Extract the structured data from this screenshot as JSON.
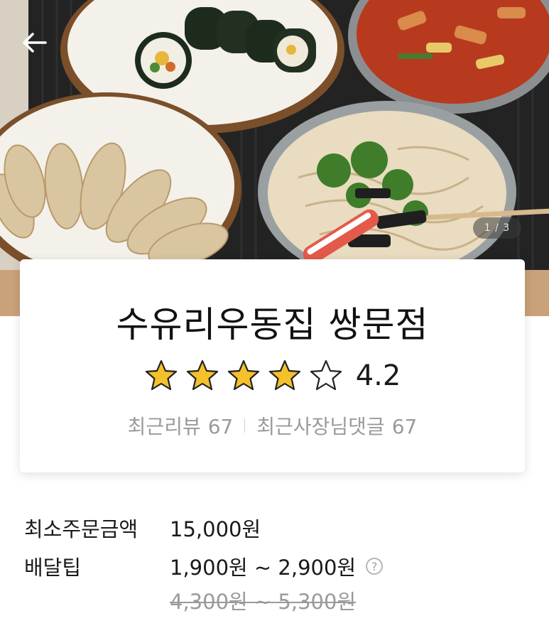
{
  "header": {
    "back_icon": "arrow-left-icon",
    "image_indicator": "1 / 3"
  },
  "store": {
    "name": "수유리우동집 쌍문점",
    "rating": 4.2,
    "rating_text": "4.2",
    "stars_filled": 4,
    "stars_total": 5,
    "recent_reviews_label": "최근리뷰",
    "recent_reviews_count": "67",
    "owner_replies_label": "최근사장님댓글",
    "owner_replies_count": "67"
  },
  "order": {
    "min_order_label": "최소주문금액",
    "min_order_value": "15,000원",
    "delivery_tip_label": "배달팁",
    "delivery_tip_value": "1,900원 ~ 2,900원",
    "delivery_tip_original": "4,300원 ~ 5,300원",
    "help_icon": "question-circle-icon"
  },
  "colors": {
    "star_fill": "#f5c12b",
    "text_primary": "#111111",
    "text_secondary": "#9a9a9a"
  }
}
